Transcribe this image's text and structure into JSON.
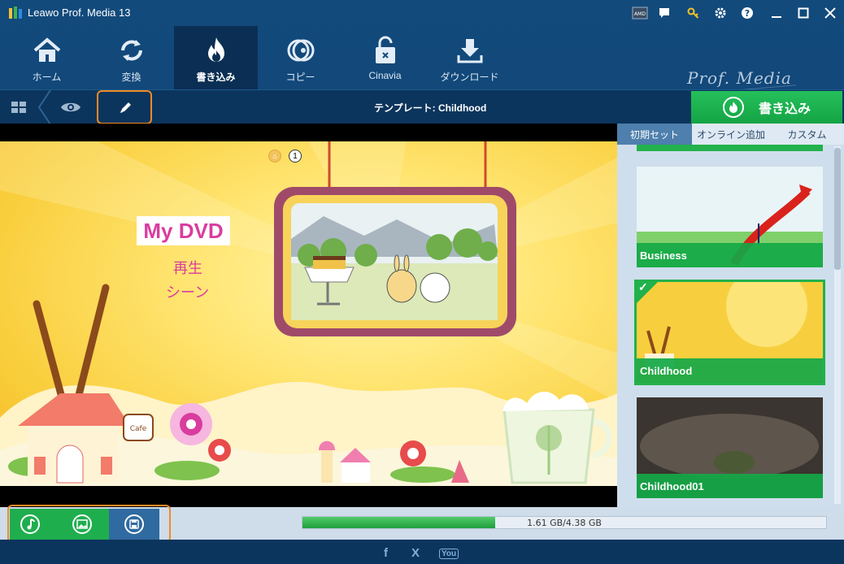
{
  "window": {
    "title": "Leawo Prof. Media 13"
  },
  "titlebar_icons": [
    "amd-icon",
    "chat-icon",
    "key-icon",
    "gear-icon",
    "help-icon",
    "minimize-icon",
    "maximize-icon",
    "close-icon"
  ],
  "nav": {
    "items": [
      {
        "label": "ホーム",
        "icon": "home-icon"
      },
      {
        "label": "変換",
        "icon": "convert-icon"
      },
      {
        "label": "書き込み",
        "icon": "burn-icon",
        "active": true
      },
      {
        "label": "コピー",
        "icon": "copy-icon"
      },
      {
        "label": "Cinavia",
        "icon": "cinavia-icon"
      },
      {
        "label": "ダウンロード",
        "icon": "download-icon"
      }
    ],
    "brand": "Prof. Media"
  },
  "subbar": {
    "template_title": "テンプレート: Childhood",
    "burn_label": "書き込み"
  },
  "preview": {
    "menu_title": "My DVD",
    "play_label": "再生",
    "scene_label": "シーン",
    "page_number": "1"
  },
  "right_panel": {
    "tabs": [
      {
        "label": "初期セット",
        "active": true
      },
      {
        "label": "オンライン追加"
      },
      {
        "label": "カスタム"
      }
    ],
    "templates": [
      {
        "name": "Business"
      },
      {
        "name": "Childhood",
        "selected": true
      },
      {
        "name": "Childhood01"
      }
    ]
  },
  "bottom": {
    "progress_text": "1.61 GB/4.38 GB",
    "progress_fraction": 0.3676,
    "tools": [
      "music-icon",
      "image-icon",
      "save-icon"
    ]
  },
  "footer": {
    "social": [
      {
        "label": "f",
        "icon": "facebook-icon"
      },
      {
        "label": "X",
        "icon": "x-icon"
      },
      {
        "label": "You",
        "icon": "youtube-icon"
      }
    ]
  },
  "colors": {
    "accent_green": "#22b14c",
    "highlight_orange": "#f08b23",
    "nav_bg": "#124a7c",
    "menu_pink": "#d93d9e"
  }
}
